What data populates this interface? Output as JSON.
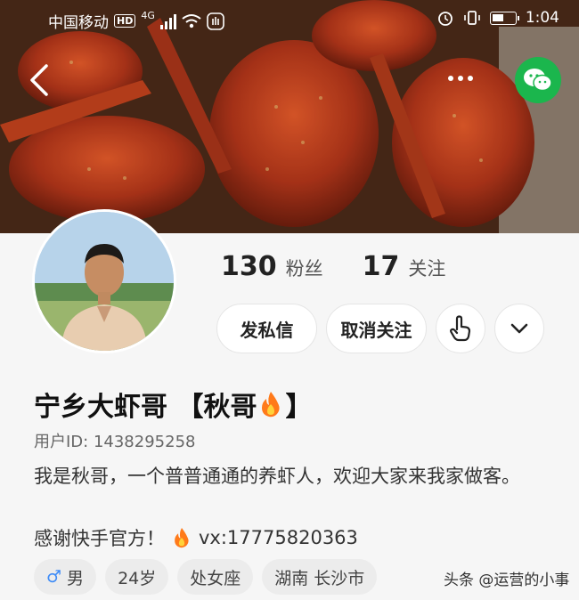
{
  "status_bar": {
    "carrier": "中国移动",
    "hd": "HD",
    "network": "4G",
    "time": "1:04"
  },
  "header": {
    "back_icon": "chevron-left-icon",
    "more_icon": "more-dots-icon",
    "share_icon": "wechat-icon"
  },
  "profile": {
    "followers_count": "130",
    "followers_label": "粉丝",
    "following_count": "17",
    "following_label": "关注",
    "name": "宁乡大虾哥 【秋哥",
    "name_suffix": "】",
    "user_id": "用户ID: 1438295258",
    "bio": "我是秋哥，一个普普通通的养虾人，欢迎大家来我家做客。",
    "thanks_prefix": "感谢快手官方！",
    "thanks_contact": "vx:17775820363"
  },
  "actions": {
    "message_label": "发私信",
    "unfollow_label": "取消关注",
    "hand_icon": "hand-pointer-icon",
    "dropdown_icon": "chevron-down-icon"
  },
  "tags": [
    {
      "icon": "♂",
      "label": "男"
    },
    {
      "label": "24岁"
    },
    {
      "label": "处女座"
    },
    {
      "label": "湖南 长沙市"
    }
  ],
  "watermark": "头条 @运营的小事",
  "colors": {
    "accent_green": "#1bb64d",
    "male_blue": "#3d8bf7",
    "fire": "#ff7a1a"
  }
}
